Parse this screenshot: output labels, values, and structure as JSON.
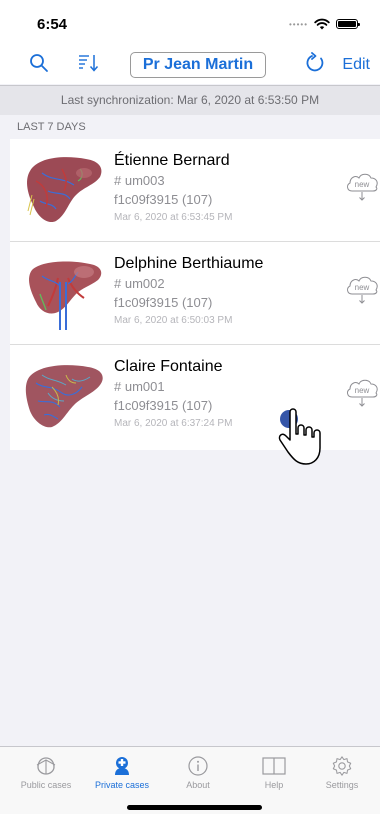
{
  "status": {
    "time": "6:54"
  },
  "toolbar": {
    "doctor": "Pr Jean Martin",
    "edit": "Edit"
  },
  "sync": {
    "text": "Last synchronization: Mar 6, 2020 at 6:53:50 PM"
  },
  "section": {
    "title": "LAST 7 DAYS"
  },
  "cases": [
    {
      "name": "Étienne Bernard",
      "id": "# um003",
      "hash": "f1c09f3915 (107)",
      "date": "Mar 6, 2020 at 6:53:45 PM",
      "badge": "new"
    },
    {
      "name": "Delphine Berthiaume",
      "id": "# um002",
      "hash": "f1c09f3915 (107)",
      "date": "Mar 6, 2020 at 6:50:03 PM",
      "badge": "new"
    },
    {
      "name": "Claire Fontaine",
      "id": "# um001",
      "hash": "f1c09f3915 (107)",
      "date": "Mar 6, 2020 at 6:37:24 PM",
      "badge": "new"
    }
  ],
  "tabs": [
    {
      "label": "Public cases",
      "icon": "public-cases-icon"
    },
    {
      "label": "Private cases",
      "icon": "private-cases-icon",
      "active": true
    },
    {
      "label": "About",
      "icon": "info-icon"
    },
    {
      "label": "Help",
      "icon": "book-icon"
    },
    {
      "label": "Settings",
      "icon": "gear-icon"
    }
  ],
  "colors": {
    "accent": "#1b6fd8",
    "background": "#f2f2f7"
  }
}
